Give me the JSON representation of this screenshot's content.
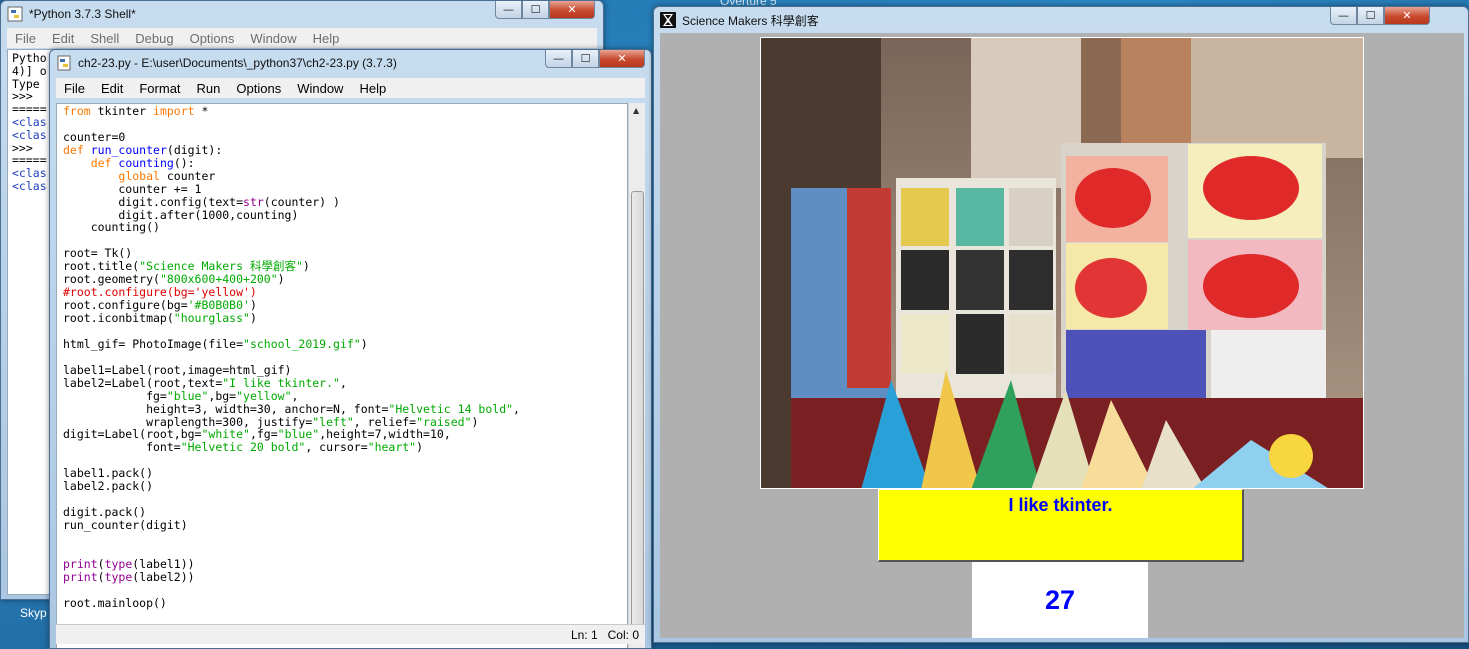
{
  "desktop": {
    "bg_label_top": "Overture 5",
    "skype_label": "Skyp"
  },
  "shell": {
    "title": "*Python 3.7.3 Shell*",
    "menu": [
      "File",
      "Edit",
      "Shell",
      "Debug",
      "Options",
      "Window",
      "Help"
    ],
    "lines": [
      "Pytho",
      "4)] o",
      "Type ",
      ">>> ",
      "=====",
      "<clas",
      "<clas",
      ">>> ",
      "=====",
      "<clas",
      "<clas"
    ]
  },
  "editor": {
    "title": "ch2-23.py - E:\\user\\Documents\\_python37\\ch2-23.py (3.7.3)",
    "menu": [
      "File",
      "Edit",
      "Format",
      "Run",
      "Options",
      "Window",
      "Help"
    ],
    "status_line": "Ln: 1",
    "status_col": "Col: 0"
  },
  "tk_app": {
    "title": "Science Makers 科學創客",
    "label2_text": "I like tkinter.",
    "counter_value": "27",
    "colors": {
      "window_bg": "#B0B0B0",
      "label2_bg": "#FFFF00",
      "label2_fg": "#0000FF",
      "digit_bg": "#FFFFFF",
      "digit_fg": "#0000FF"
    }
  },
  "window_controls": {
    "minimize": "—",
    "maximize": "☐",
    "close": "✕"
  }
}
